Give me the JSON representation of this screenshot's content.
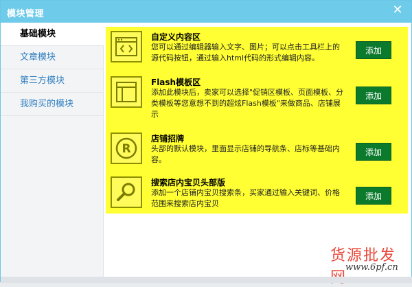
{
  "dialog": {
    "title": "模块管理",
    "close_icon": "close-icon"
  },
  "sidebar": {
    "items": [
      {
        "label": "基础模块",
        "active": true
      },
      {
        "label": "文章模块",
        "active": false
      },
      {
        "label": "第三方模块",
        "active": false
      },
      {
        "label": "我购买的模块",
        "active": false
      }
    ]
  },
  "modules": [
    {
      "title": "自定义内容区",
      "description": "您可以通过编辑器输入文字、图片；可以点击工具栏上的源代码按钮，通过输入html代码的形式编辑内容。",
      "icon": "code-window-icon",
      "button": "添加"
    },
    {
      "title": "Flash模板区",
      "description": "添加此模块后，卖家可以选择\"促销区模板、页面模板、分类模板等您意想不到的超炫Flash模板\"来做商品、店铺展示",
      "icon": "layout-template-icon",
      "button": "添加"
    },
    {
      "title": "店铺招牌",
      "description": "头部的默认模块，里面显示店铺的导航条、店标等基础内容。",
      "icon": "registered-sign-icon",
      "button": "添加"
    },
    {
      "title": "搜索店内宝贝头部版",
      "description": "添加一个店铺内宝贝搜索条，买家通过输入关键词、价格范围来搜索店内宝贝",
      "icon": "search-icon",
      "button": "添加"
    }
  ],
  "watermark": {
    "line1": "货源批发网",
    "line2": "www.6pf.cn"
  },
  "colors": {
    "titlebar": "#6ecbea",
    "content_bg": "#ffff33",
    "button_bg": "#0b7a2c",
    "link": "#2f7fc0"
  }
}
